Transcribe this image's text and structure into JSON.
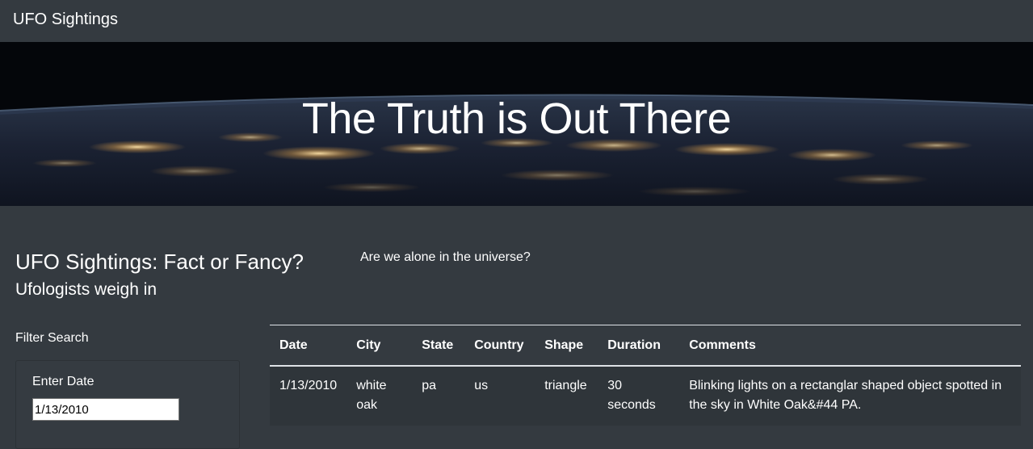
{
  "navbar": {
    "brand": "UFO Sightings"
  },
  "hero": {
    "title": "The Truth is Out There"
  },
  "intro": {
    "title": "UFO Sightings: Fact or Fancy?",
    "subtitle": "Ufologists weigh in",
    "question": "Are we alone in the universe?"
  },
  "filter": {
    "heading": "Filter Search",
    "date_label": "Enter Date",
    "date_value": "1/13/2010"
  },
  "table": {
    "headers": {
      "date": "Date",
      "city": "City",
      "state": "State",
      "country": "Country",
      "shape": "Shape",
      "duration": "Duration",
      "comments": "Comments"
    },
    "rows": [
      {
        "date": "1/13/2010",
        "city": "white oak",
        "state": "pa",
        "country": "us",
        "shape": "triangle",
        "duration": "30 seconds",
        "comments": "Blinking lights on a rectanglar shaped object spotted in the sky in White Oak&#44 PA."
      }
    ]
  },
  "colors": {
    "page_background": "#343a40",
    "text": "#ffffff",
    "table_row_background": "#2f353a"
  }
}
